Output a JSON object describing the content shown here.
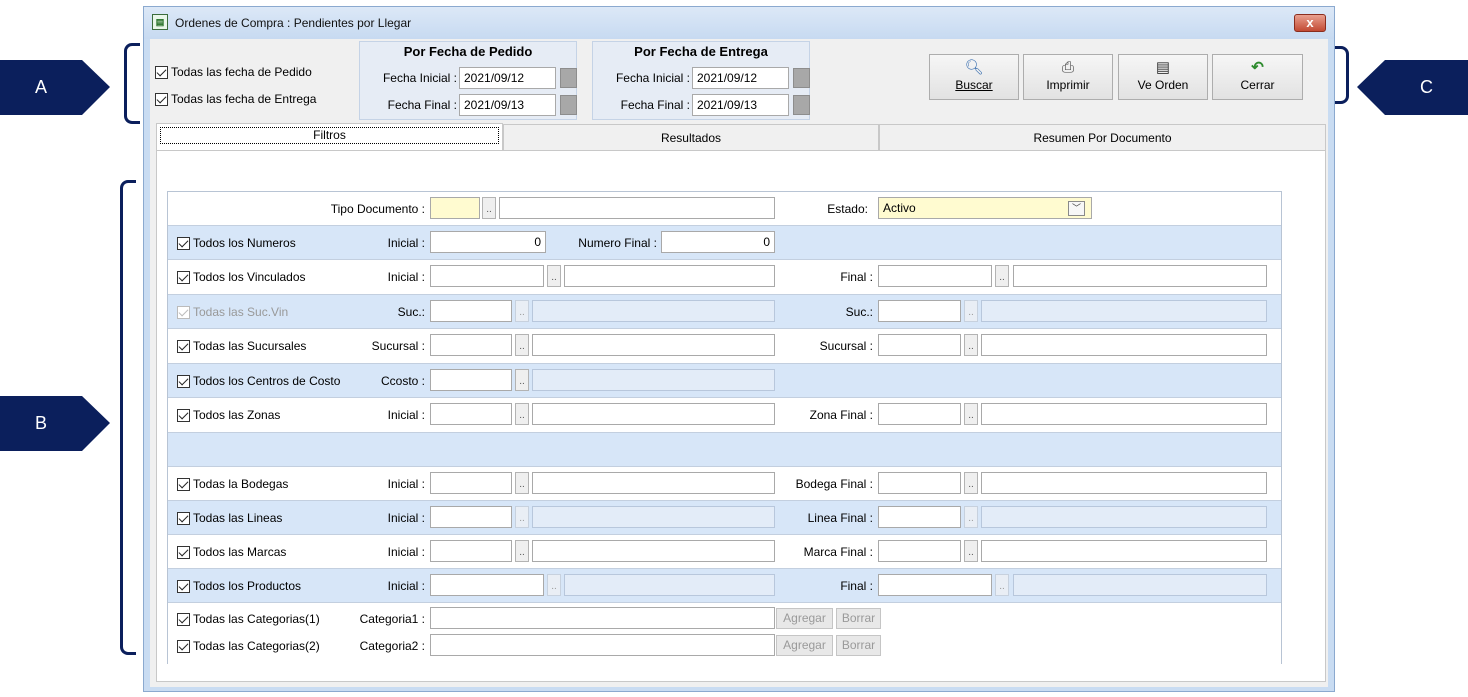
{
  "callouts": {
    "a": "A",
    "b": "B",
    "c": "C"
  },
  "window": {
    "title": "Ordenes de Compra : Pendientes por Llegar",
    "close_icon": "x"
  },
  "header": {
    "chk_pedido": "Todas las fecha de Pedido",
    "chk_entrega": "Todas las fecha de Entrega",
    "pedido_group": {
      "title": "Por Fecha de Pedido",
      "fecha_inicial_label": "Fecha Inicial :",
      "fecha_inicial": "2021/09/12",
      "fecha_final_label": "Fecha Final :",
      "fecha_final": "2021/09/13"
    },
    "entrega_group": {
      "title": "Por Fecha de Entrega",
      "fecha_inicial_label": "Fecha Inicial :",
      "fecha_inicial": "2021/09/12",
      "fecha_final_label": "Fecha Final :",
      "fecha_final": "2021/09/13"
    }
  },
  "toolbar": {
    "buscar": "Buscar",
    "imprimir": "Imprimir",
    "ve_orden": "Ve Orden",
    "cerrar": "Cerrar"
  },
  "tabs": [
    "Filtros",
    "Resultados",
    "Resumen Por Documento"
  ],
  "filtros": {
    "tipo_documento_label": "Tipo Documento :",
    "estado_label": "Estado:",
    "estado_value": "Activo",
    "numeros": {
      "chk": "Todos los Numeros",
      "inicial_label": "Inicial :",
      "inicial": "0",
      "final_label": "Numero Final :",
      "final": "0"
    },
    "vinculados": {
      "chk": "Todos los Vinculados",
      "inicial_label": "Inicial :",
      "final_label": "Final :"
    },
    "suc_vin": {
      "chk": "Todas las Suc.Vin",
      "label1": "Suc.:",
      "label2": "Suc.:"
    },
    "sucursales": {
      "chk": "Todas las Sucursales",
      "label1": "Sucursal :",
      "label2": "Sucursal :"
    },
    "centros": {
      "chk": "Todos los Centros de Costo",
      "label": "Ccosto :"
    },
    "zonas": {
      "chk": "Todos las Zonas",
      "inicial_label": "Inicial :",
      "final_label": "Zona Final :"
    },
    "bodegas": {
      "chk": "Todas la Bodegas",
      "inicial_label": "Inicial :",
      "final_label": "Bodega Final :"
    },
    "lineas": {
      "chk": "Todas las Lineas",
      "inicial_label": "Inicial :",
      "final_label": "Linea Final :"
    },
    "marcas": {
      "chk": "Todos las Marcas",
      "inicial_label": "Inicial :",
      "final_label": "Marca Final :"
    },
    "productos": {
      "chk": "Todos los Productos",
      "inicial_label": "Inicial :",
      "final_label": "Final :"
    },
    "categorias1": {
      "chk": "Todas las Categorias(1)",
      "label": "Categoria1 :",
      "agregar": "Agregar",
      "borrar": "Borrar"
    },
    "categorias2": {
      "chk": "Todas las Categorias(2)",
      "label": "Categoria2 :",
      "agregar": "Agregar",
      "borrar": "Borrar"
    },
    "dots": ".."
  }
}
